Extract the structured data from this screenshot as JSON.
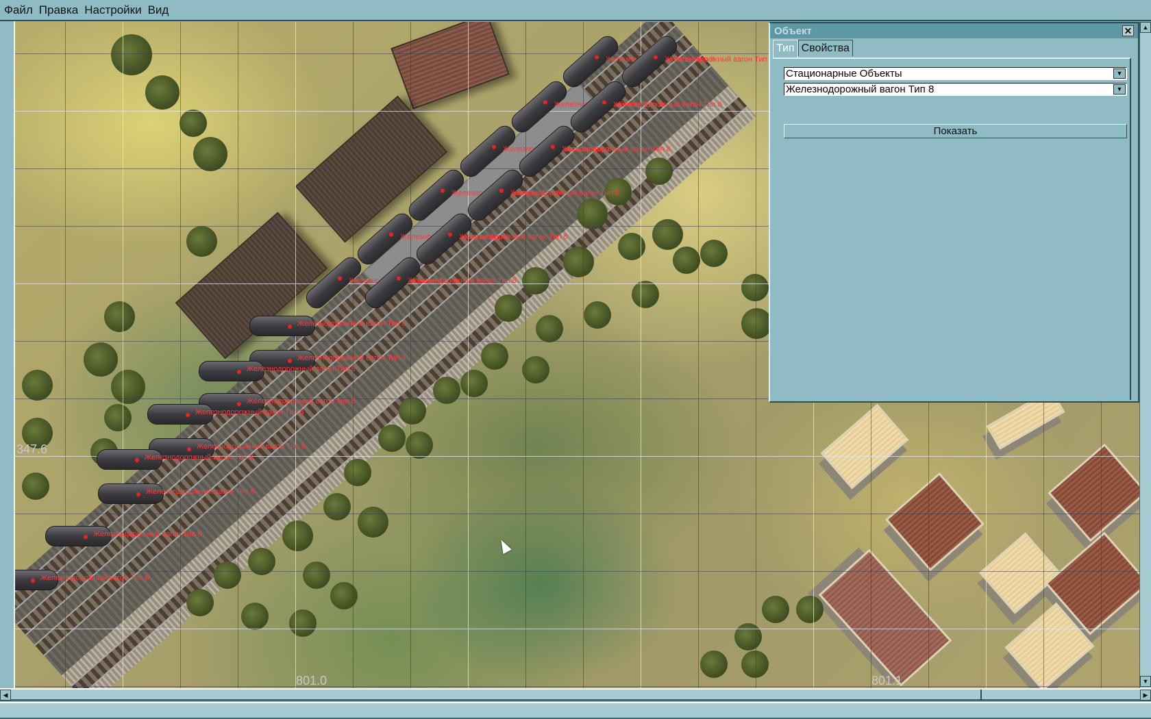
{
  "menu": [
    "Файл",
    "Правка",
    "Настройки",
    "Вид"
  ],
  "map": {
    "coord_left": "347.6",
    "coord_bottom_1": "801.0",
    "coord_bottom_2": "801.1",
    "wagon_label": "Железнодорожный вагон Тип 8",
    "wagon_count": 22
  },
  "panel": {
    "title": "Объект",
    "close": "✕",
    "tabs": [
      "Тип",
      "Свойства"
    ],
    "active_tab": "Тип",
    "category_value": "Стационарные Объекты",
    "object_value": "Железнодорожный вагон Тип 8",
    "show_button": "Показать"
  },
  "scrollbars": {
    "up": "▲",
    "down": "▼",
    "left": "◀",
    "right": "▶"
  },
  "colors": {
    "label": "#ff3a3a",
    "panel": "#8fbcc4",
    "title": "#5d98a4"
  }
}
